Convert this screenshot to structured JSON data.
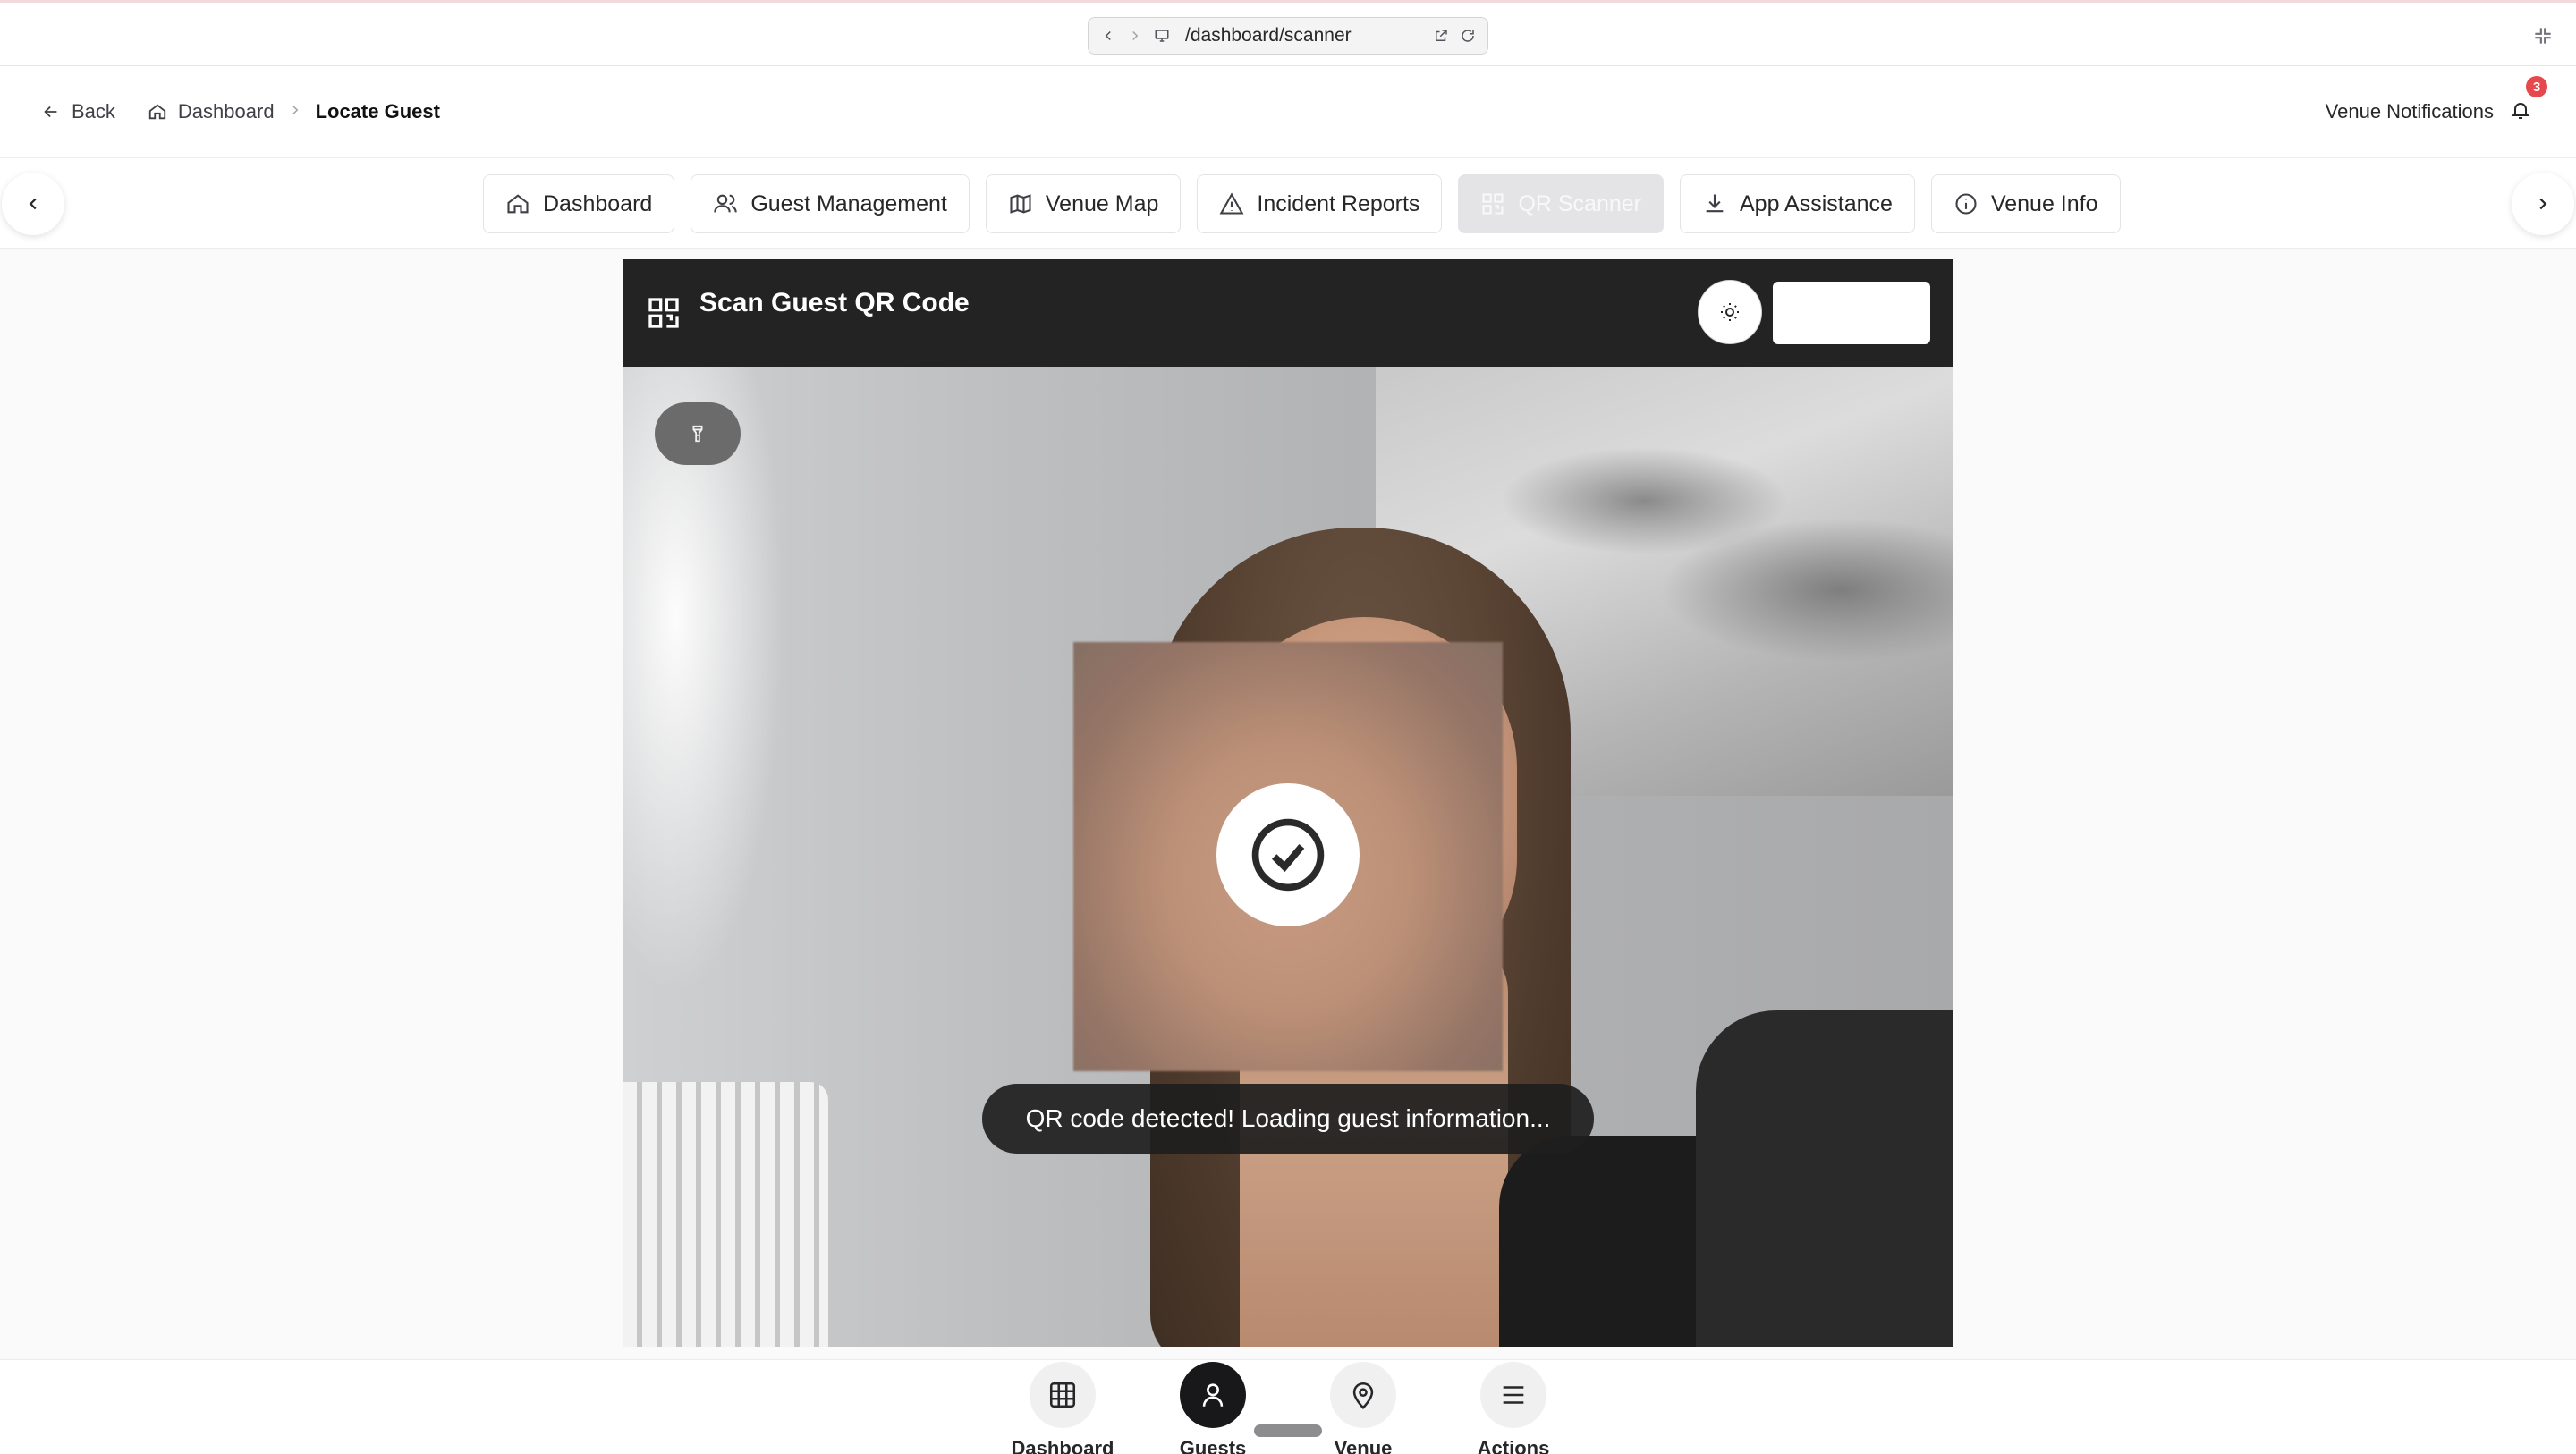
{
  "browser": {
    "url": "/dashboard/scanner"
  },
  "header": {
    "back_label": "Back",
    "breadcrumbs": [
      "Dashboard",
      "Locate Guest"
    ],
    "notifications_label": "Venue Notifications",
    "notifications_count": "3"
  },
  "tabs": [
    {
      "label": "Dashboard",
      "icon": "home-icon",
      "active": false
    },
    {
      "label": "Guest Management",
      "icon": "users-icon",
      "active": false
    },
    {
      "label": "Venue Map",
      "icon": "map-icon",
      "active": false
    },
    {
      "label": "Incident Reports",
      "icon": "warning-icon",
      "active": false
    },
    {
      "label": "QR Scanner",
      "icon": "qr-icon",
      "active": true
    },
    {
      "label": "App Assistance",
      "icon": "download-icon",
      "active": false
    },
    {
      "label": "Venue Info",
      "icon": "info-icon",
      "active": false
    }
  ],
  "scanner": {
    "title": "Scan Guest QR Code",
    "status_message": "QR code detected! Loading guest information..."
  },
  "bottom_nav": [
    {
      "label": "Dashboard",
      "icon": "grid-icon",
      "active": false
    },
    {
      "label": "Guests",
      "icon": "user-icon",
      "active": true
    },
    {
      "label": "Venue",
      "icon": "map-pin-icon",
      "active": false
    },
    {
      "label": "Actions",
      "icon": "menu-icon",
      "active": false
    }
  ],
  "colors": {
    "accent": "#18181b",
    "badge": "#e5484d",
    "scanner_header": "#232323"
  }
}
